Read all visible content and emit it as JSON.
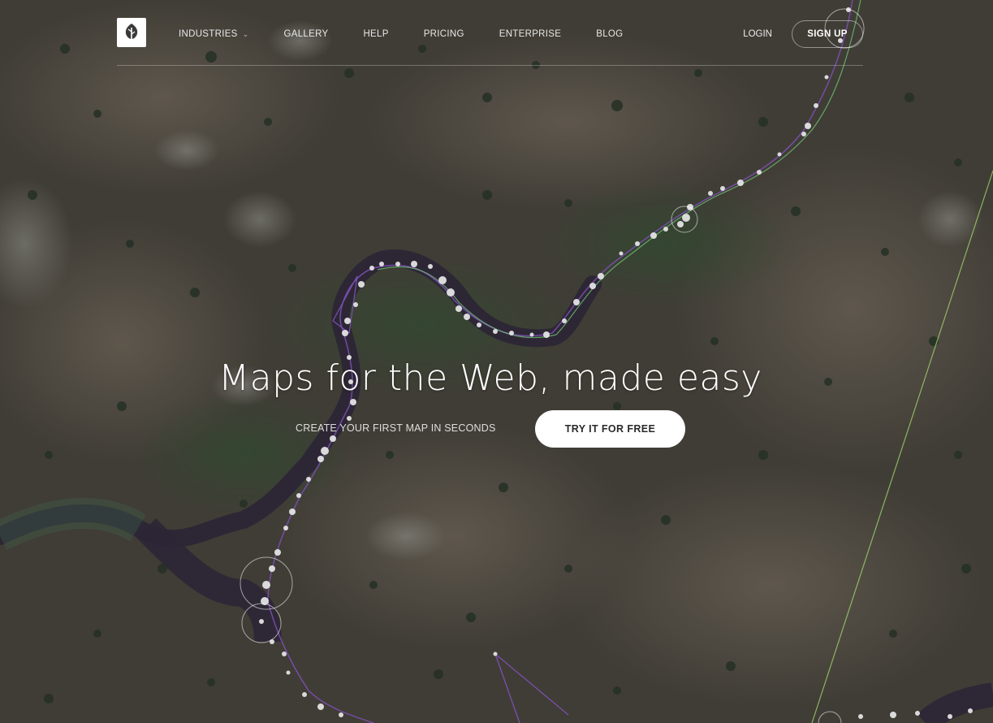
{
  "nav": {
    "logo_icon": "leaf-icon",
    "items": [
      {
        "label": "INDUSTRIES",
        "has_dropdown": true
      },
      {
        "label": "GALLERY"
      },
      {
        "label": "HELP"
      },
      {
        "label": "PRICING"
      },
      {
        "label": "ENTERPRISE"
      },
      {
        "label": "BLOG"
      }
    ],
    "login_label": "LOGIN",
    "signup_label": "SIGN UP"
  },
  "hero": {
    "title": "Maps for the Web, made easy",
    "subtitle": "CREATE YOUR FIRST MAP IN SECONDS",
    "cta_label": "TRY IT FOR FREE"
  },
  "map": {
    "style": "satellite",
    "track_colors": [
      "#e8e8e8",
      "#7a4fb0",
      "#6fbf73",
      "#9dd36b"
    ]
  }
}
